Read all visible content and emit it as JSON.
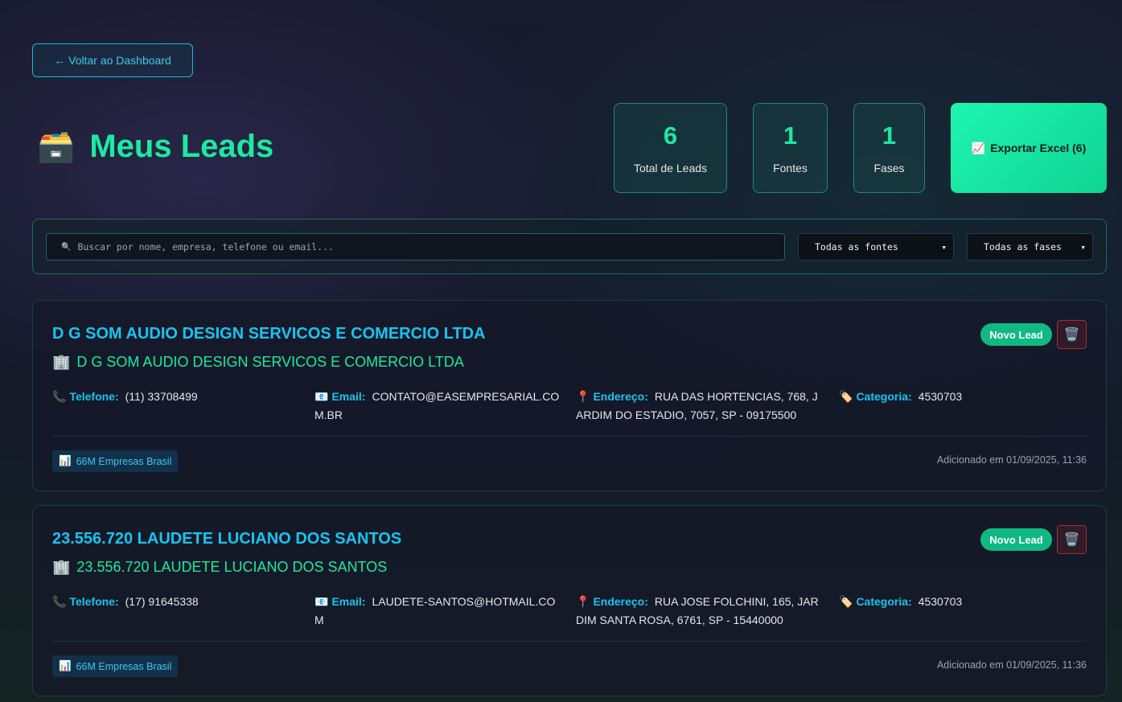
{
  "back_button": {
    "label": "← Voltar ao Dashboard"
  },
  "header": {
    "icon": "🗃️",
    "title": "Meus Leads"
  },
  "stats": [
    {
      "value": "6",
      "label": "Total de Leads"
    },
    {
      "value": "1",
      "label": "Fontes"
    },
    {
      "value": "1",
      "label": "Fases"
    }
  ],
  "export_button": {
    "icon": "📈",
    "label": "Exportar Excel (6)"
  },
  "filters": {
    "search_icon": "🔍",
    "search_placeholder": "Buscar por nome, empresa, telefone ou email...",
    "source_select": "Todas as fontes",
    "phase_select": "Todas as fases"
  },
  "field_labels": {
    "phone": "Telefone:",
    "email": "Email:",
    "address": "Endereço:",
    "category": "Categoria:"
  },
  "icons": {
    "company": "🏢",
    "phone": "📞",
    "email": "📧",
    "address": "📍",
    "category": "🏷️",
    "source": "📊",
    "delete": "🗑️"
  },
  "leads": [
    {
      "name": "D G SOM AUDIO DESIGN SERVICOS E COMERCIO LTDA",
      "company": "D G SOM AUDIO DESIGN SERVICOS E COMERCIO LTDA",
      "status": "Novo Lead",
      "phone": "(11) 33708499",
      "email_line1": "CONTATO@EASEMPRESARIAL.CO",
      "email_line2": "M.BR",
      "address_line1": "RUA DAS HORTENCIAS, 768, J",
      "address_line2": "ARDIM DO ESTADIO, 7057, SP - 09175500",
      "category": "4530703",
      "source": "66M Empresas Brasil",
      "added": "Adicionado em 01/09/2025, 11:36"
    },
    {
      "name": "23.556.720 LAUDETE LUCIANO DOS SANTOS",
      "company": "23.556.720 LAUDETE LUCIANO DOS SANTOS",
      "status": "Novo Lead",
      "phone": "(17) 91645338",
      "email_line1": "LAUDETE-SANTOS@HOTMAIL.CO",
      "email_line2": "M",
      "address_line1": "RUA JOSE FOLCHINI, 165, JAR",
      "address_line2": "DIM SANTA ROSA, 6761, SP - 15440000",
      "category": "4530703",
      "source": "66M Empresas Brasil",
      "added": "Adicionado em 01/09/2025, 11:36"
    }
  ]
}
